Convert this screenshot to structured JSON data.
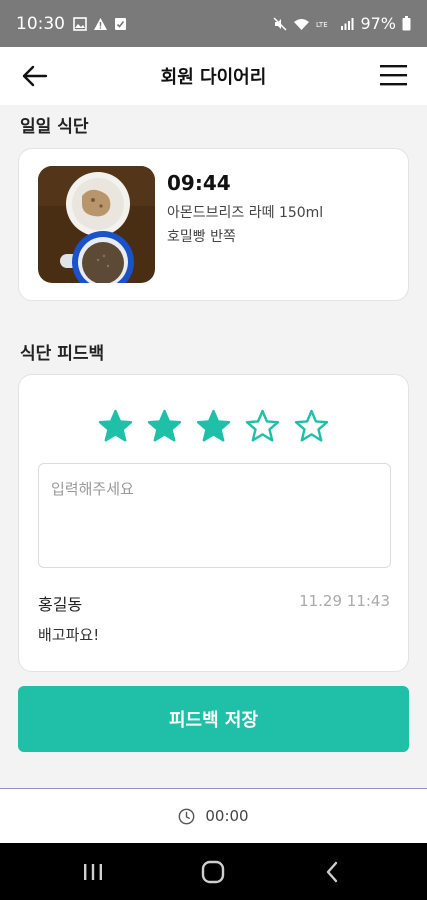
{
  "status_bar": {
    "time": "10:30",
    "battery": "97%",
    "left_icons": [
      "image-icon",
      "warning-icon",
      "check-icon"
    ],
    "right_icons": [
      "mute-icon",
      "wifi-icon",
      "lte-icon",
      "signal-icon",
      "battery-icon"
    ]
  },
  "header": {
    "title": "회원 다이어리"
  },
  "daily_meal": {
    "section_title": "일일 식단",
    "time": "09:44",
    "items": [
      "아몬드브리즈 라떼 150ml",
      "호밀빵 반쪽"
    ]
  },
  "feedback": {
    "section_title": "식단 피드백",
    "rating": 3,
    "max_rating": 5,
    "star_color": "#1fbfa8",
    "input_placeholder": "입력해주세요",
    "input_value": "",
    "author": "홍길동",
    "timestamp": "11.29 11:43",
    "comment": "배고파요!"
  },
  "save_button_label": "피드백 저장",
  "timer": {
    "value": "00:00"
  },
  "colors": {
    "accent": "#1fbfa8",
    "status_bar": "#7a7a7a"
  }
}
